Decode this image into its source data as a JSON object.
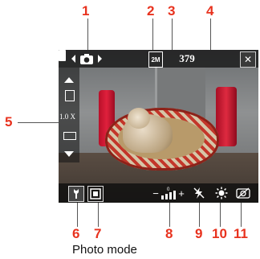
{
  "callouts": [
    "1",
    "2",
    "3",
    "4",
    "5",
    "6",
    "7",
    "8",
    "9",
    "10",
    "11"
  ],
  "topbar": {
    "mode_icon": "camera-icon",
    "resolution_label": "2M",
    "counter": "379",
    "close_glyph": "✕"
  },
  "zoom": {
    "value": "1.0 X"
  },
  "bottombar": {
    "ev_minus": "−",
    "ev_plus": "+",
    "ev_value": "0"
  },
  "caption": "Photo mode"
}
